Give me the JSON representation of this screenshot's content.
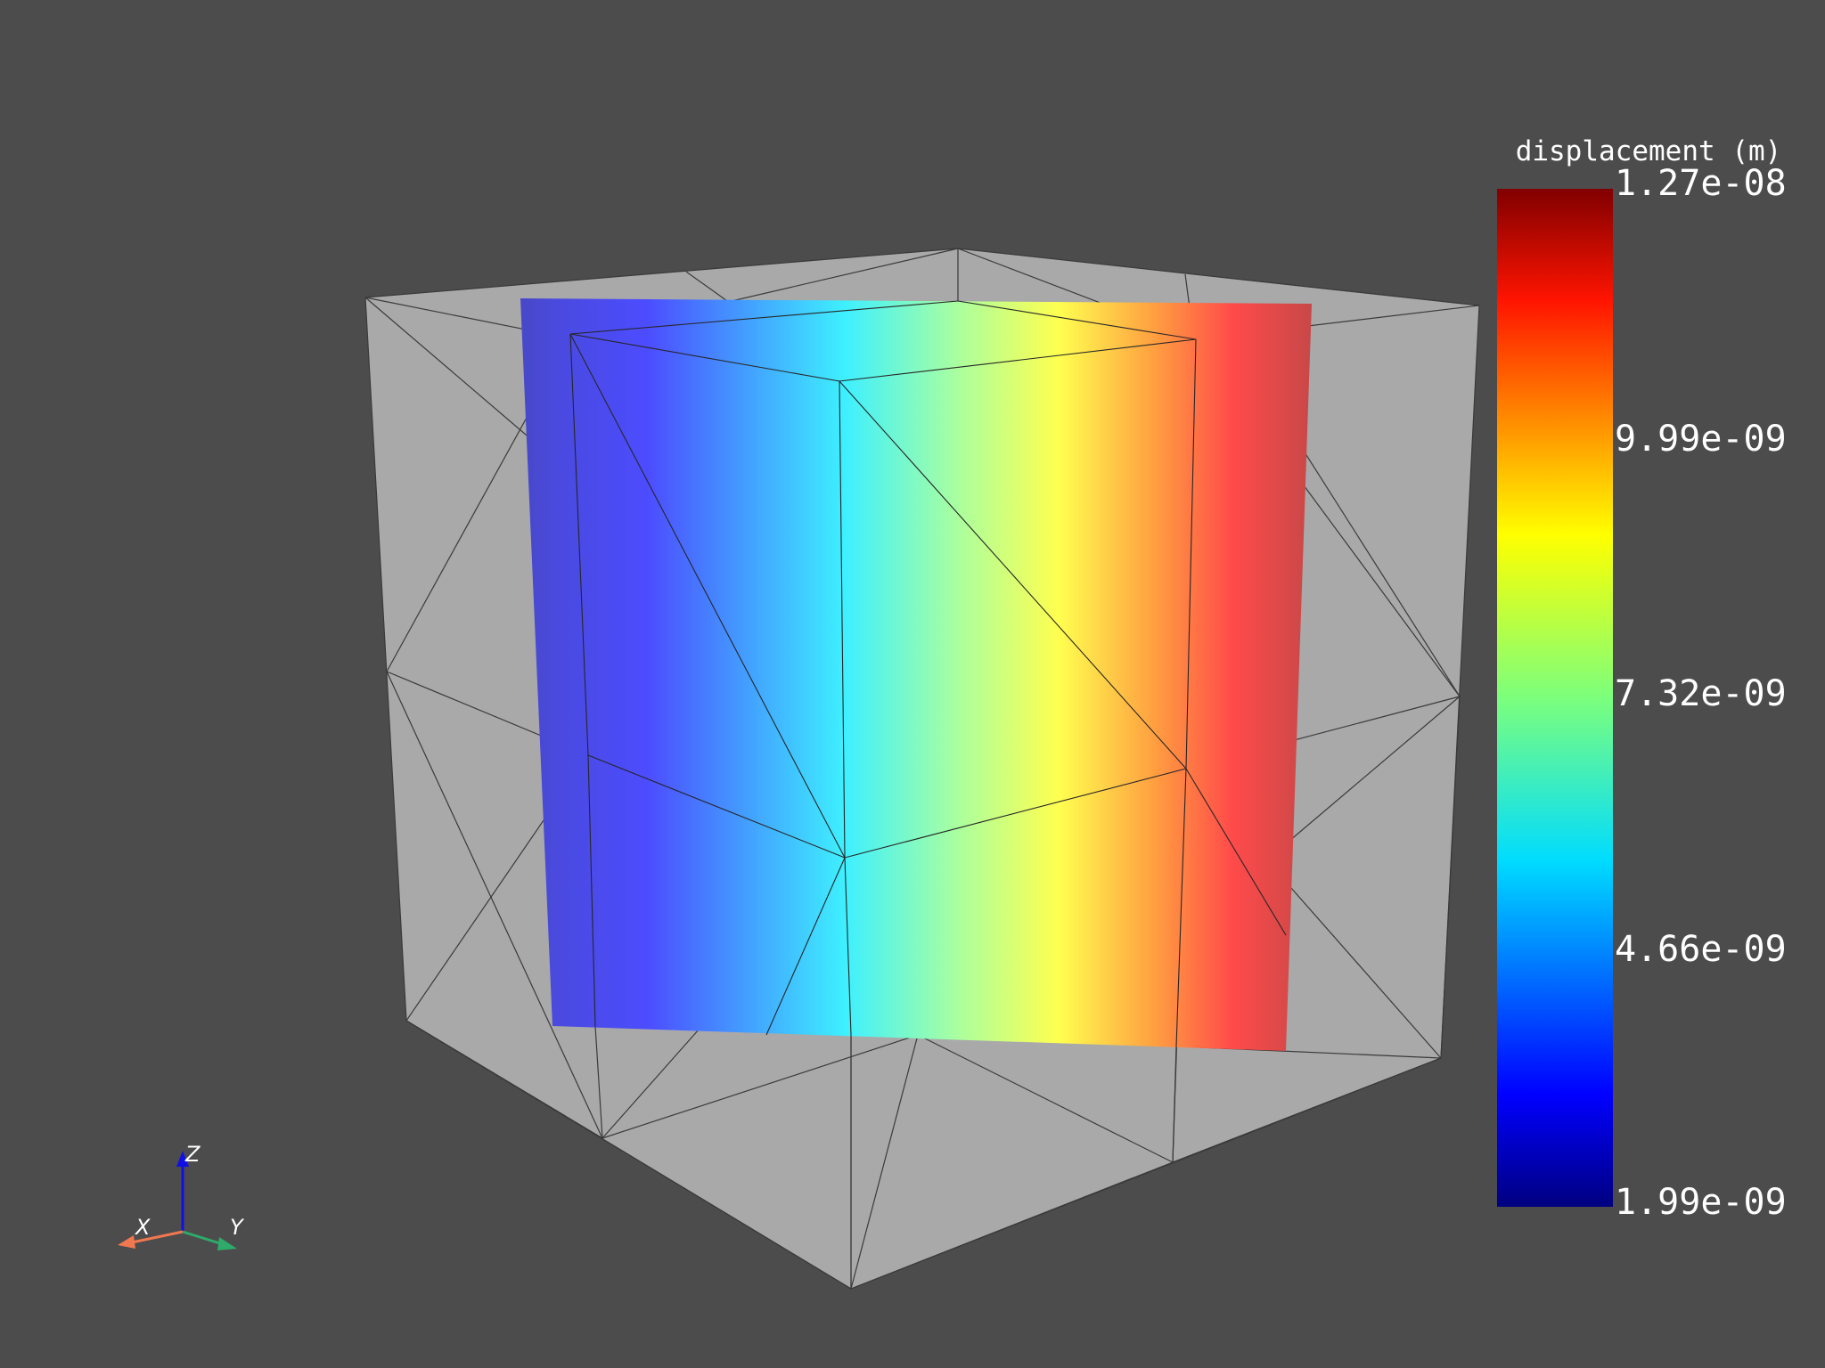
{
  "viewer": {
    "background": "#4c4c4c",
    "mesh_color": "#a9a9a9",
    "edge_color": "#2b2b2b"
  },
  "colorbar": {
    "title": "displacement (m)",
    "colormap": "jet",
    "min": "1.99e-09",
    "max": "1.27e-08",
    "labels": [
      "1.27e-08",
      "9.99e-09",
      "7.32e-09",
      "4.66e-09",
      "1.99e-09"
    ]
  },
  "axes": {
    "x_label": "X",
    "y_label": "Y",
    "z_label": "Z",
    "x_color": "#f07850",
    "y_color": "#2faa6b",
    "z_color": "#1010e6"
  }
}
